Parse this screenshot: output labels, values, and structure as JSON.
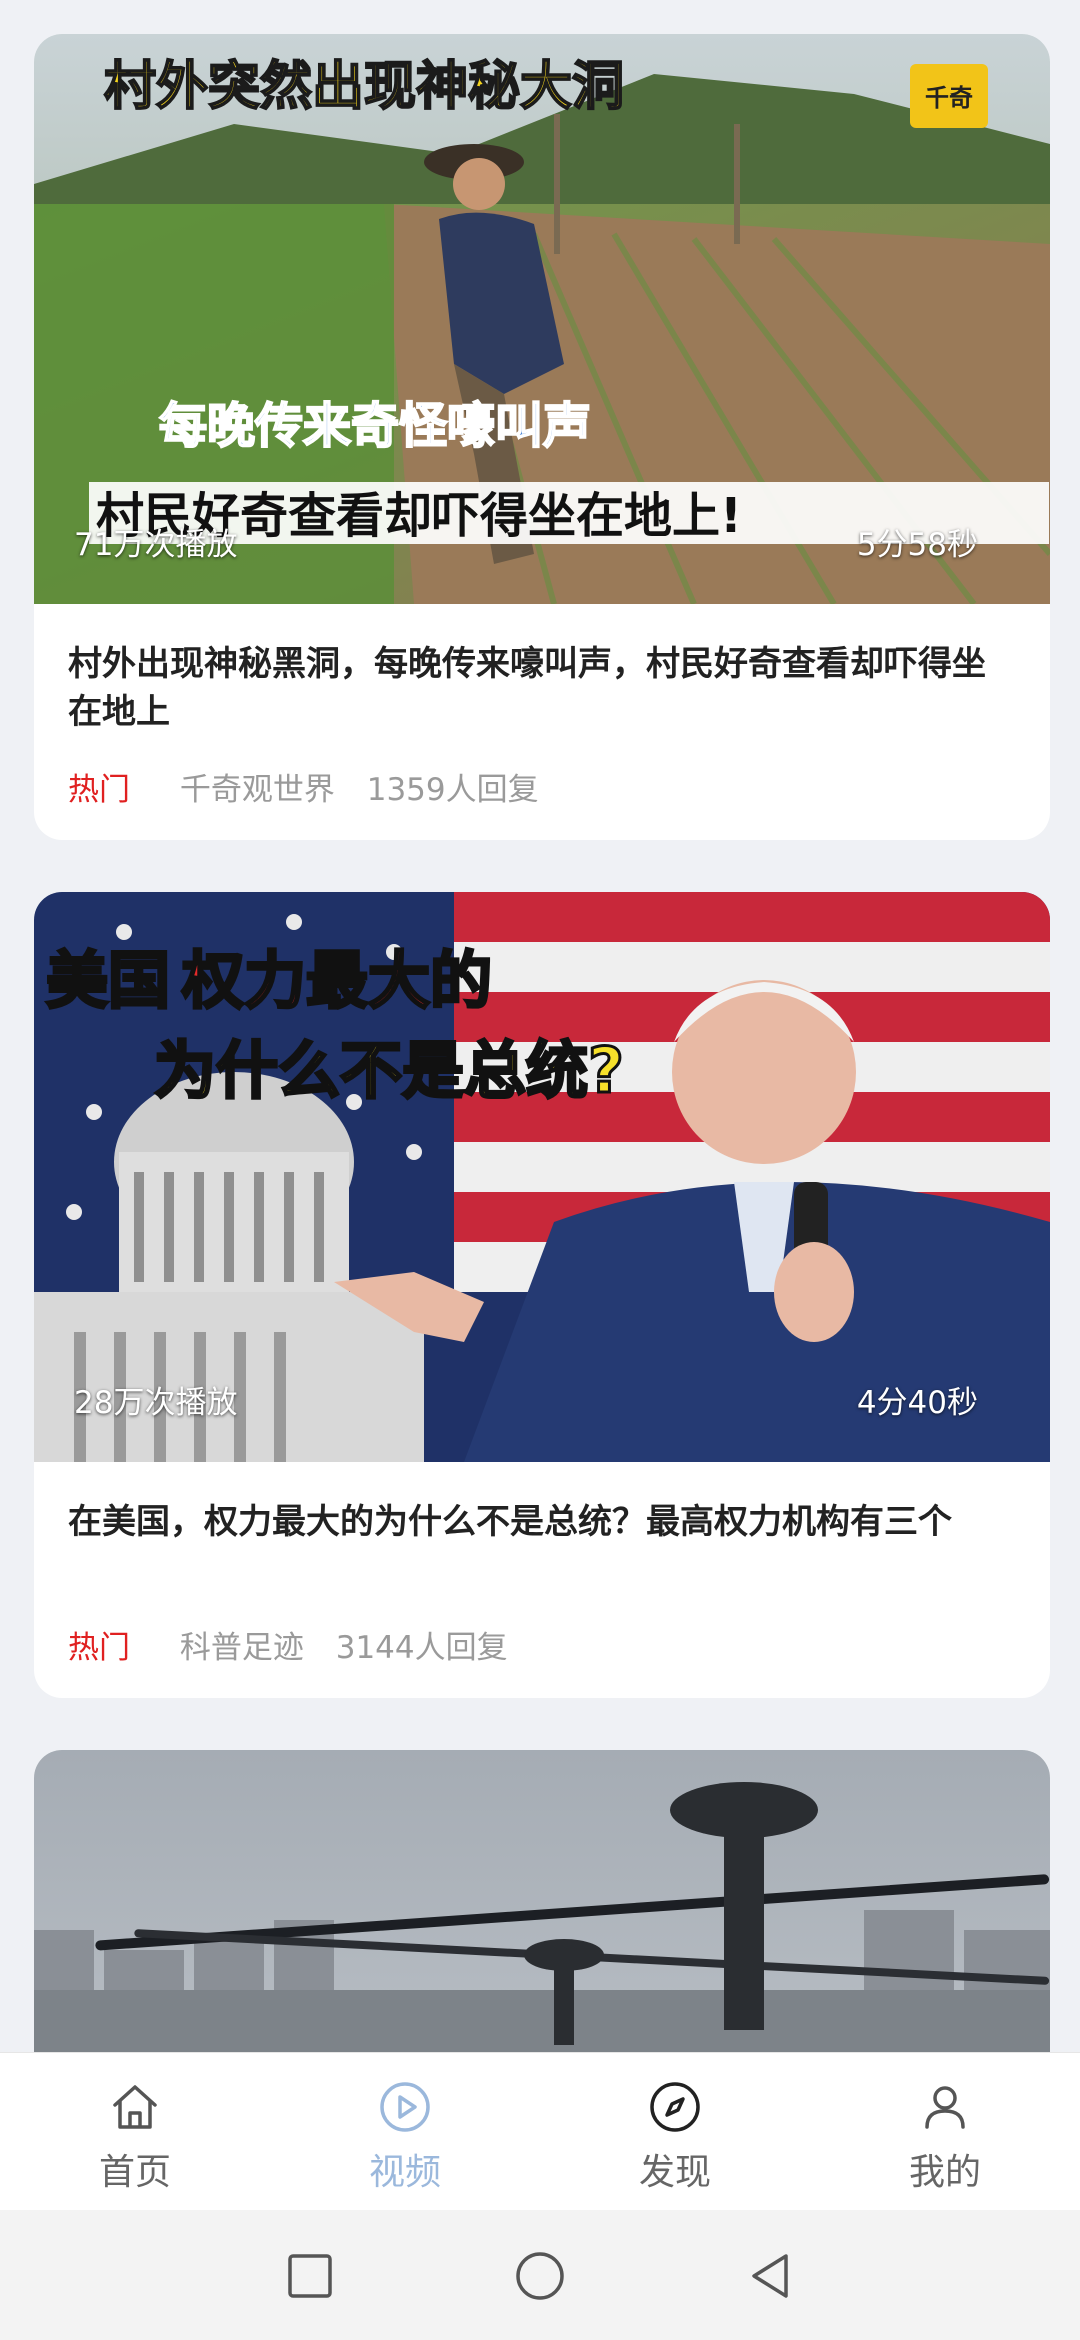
{
  "feed": [
    {
      "thumb_caption_top": "村外突然出现神秘大洞",
      "thumb_caption_mid": "每晚传来奇怪嚎叫声",
      "thumb_caption_bottom": "村民好奇查看却吓得坐在地上!",
      "logo_text": "千奇",
      "views": "71万次播放",
      "duration": "5分58秒",
      "title": "村外出现神秘黑洞，每晚传来嚎叫声，村民好奇查看却吓得坐在地上",
      "tag": "热门",
      "source": "千奇观世界",
      "replies": "1359人回复"
    },
    {
      "thumb_caption_top_white": "美国",
      "thumb_caption_top_red": "权力最大的",
      "thumb_caption_mid": "为什么不是总统?",
      "views": "28万次播放",
      "duration": "4分40秒",
      "title": "在美国，权力最大的为什么不是总统？最高权力机构有三个",
      "tag": "热门",
      "source": "科普足迹",
      "replies": "3144人回复"
    }
  ],
  "bottom_nav": [
    {
      "label": "首页",
      "icon": "home-icon",
      "active": false
    },
    {
      "label": "视频",
      "icon": "play-circle-icon",
      "active": true
    },
    {
      "label": "发现",
      "icon": "compass-icon",
      "active": false
    },
    {
      "label": "我的",
      "icon": "user-icon",
      "active": false
    }
  ],
  "colors": {
    "tag": "#e02020",
    "active_tab": "#9bb8dc",
    "background": "#eff1f5"
  }
}
